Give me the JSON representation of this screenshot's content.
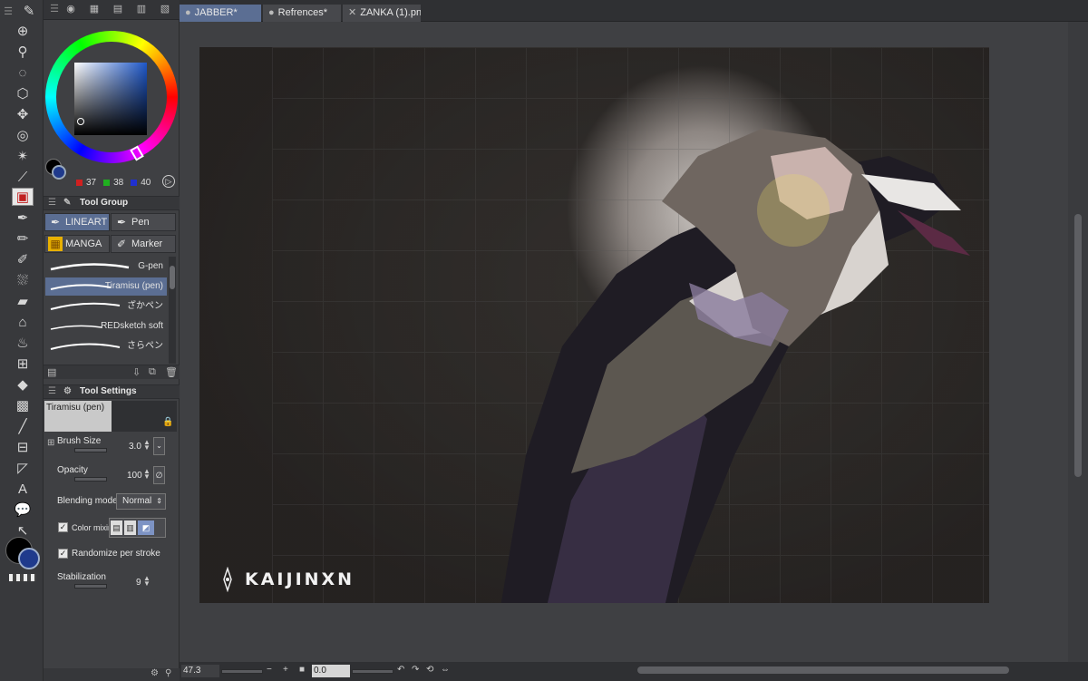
{
  "tabs": [
    {
      "label": "JABBER*",
      "prefix": "●",
      "selected": true
    },
    {
      "label": "Refrences*",
      "prefix": "●",
      "selected": false
    },
    {
      "label": "ZANKA (1).png",
      "prefix": "✕",
      "selected": false
    }
  ],
  "color": {
    "r": "37",
    "g": "38",
    "b": "40",
    "main_hex": "#000000",
    "sub_hex": "#1f3a8c"
  },
  "tool_group": {
    "title": "Tool Group",
    "items": [
      {
        "label": "LINEART",
        "icon": "pen-nib-icon",
        "selected": true
      },
      {
        "label": "Pen",
        "icon": "pen-nib-icon",
        "selected": false
      },
      {
        "label": "MANGA",
        "icon": "screentone-icon",
        "selected": false
      },
      {
        "label": "Marker",
        "icon": "marker-icon",
        "selected": false
      }
    ]
  },
  "brushes": [
    {
      "label": "G-pen",
      "selected": false
    },
    {
      "label": "Tiramisu (pen)",
      "selected": true
    },
    {
      "label": "ざかペン",
      "selected": false
    },
    {
      "label": "REDsketch soft",
      "selected": false
    },
    {
      "label": "さらペン",
      "selected": false
    }
  ],
  "tool_settings": {
    "title": "Tool Settings",
    "brush_name": "Tiramisu (pen)",
    "brush_size_label": "Brush Size",
    "brush_size": "3.0",
    "opacity_label": "Opacity",
    "opacity": "100",
    "blending_label": "Blending mode",
    "blending": "Normal",
    "color_mixing_label": "Color mixin",
    "randomize_label": "Randomize per stroke",
    "stabilization_label": "Stabilization",
    "stabilization": "9"
  },
  "status": {
    "zoom": "47.3",
    "angle": "0.0"
  },
  "artwork": {
    "watermark": "KAIJINXN"
  }
}
